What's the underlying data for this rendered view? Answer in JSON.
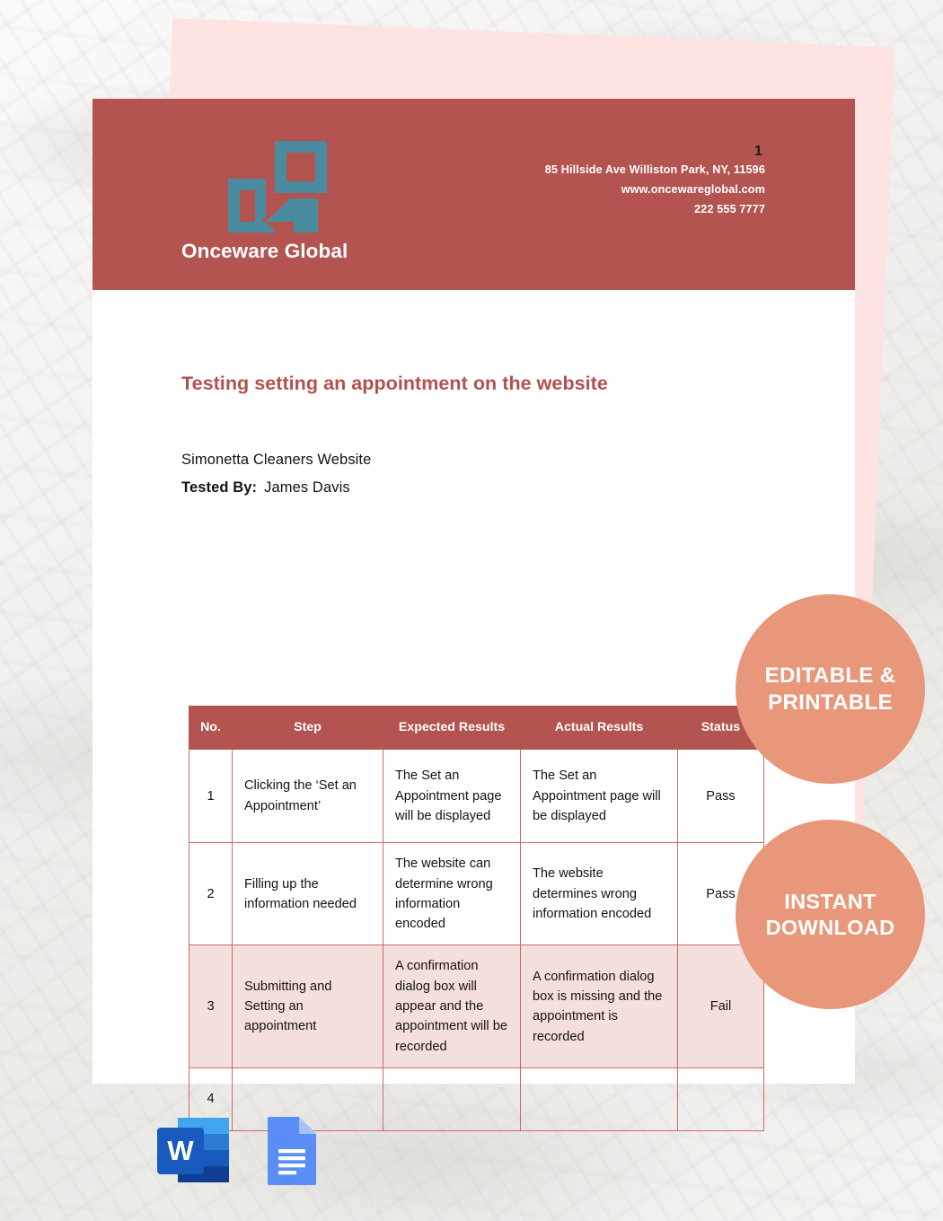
{
  "document": {
    "page_number": "1",
    "brand": {
      "name": "Onceware Global",
      "logo_icon": "onceware-geometric-logo-icon",
      "logo_color": "#4a8ba0",
      "band_color": "#b35450"
    },
    "contact": {
      "address": "85 Hillside Ave Williston Park, NY, 11596",
      "website": "www.oncewareglobal.com",
      "phone": "222 555 7777"
    },
    "title": "Testing setting an appointment on the website",
    "subject": "Simonetta Cleaners Website",
    "tested_by_label": "Tested By:",
    "tested_by_value": "James Davis"
  },
  "table": {
    "headers": [
      "No.",
      "Step",
      "Expected Results",
      "Actual Results",
      "Status"
    ],
    "rows": [
      {
        "no": "1",
        "step": "Clicking the ‘Set an Appointment’",
        "expected": "The Set an Appointment page will be displayed",
        "actual": "The Set an Appointment page will be displayed",
        "status": "Pass",
        "shaded": false
      },
      {
        "no": "2",
        "step": "Filling up the information needed",
        "expected": "The website can determine wrong information encoded",
        "actual": "The website determines wrong information encoded",
        "status": "Pass",
        "shaded": false
      },
      {
        "no": "3",
        "step": "Submitting and Setting an appointment",
        "expected": "A confirmation dialog box will appear and the appointment will be recorded",
        "actual": "A confirmation dialog box is missing and the appointment is recorded",
        "status": "Fail",
        "shaded": true
      },
      {
        "no": "4",
        "step": "",
        "expected": "",
        "actual": "",
        "status": "",
        "shaded": false
      }
    ]
  },
  "badges": {
    "editable": "EDITABLE & PRINTABLE",
    "download": "INSTANT DOWNLOAD",
    "color": "#e8977a"
  },
  "format_icons": [
    {
      "name": "microsoft-word-icon",
      "label": "W"
    },
    {
      "name": "google-docs-icon",
      "label": ""
    }
  ],
  "colors": {
    "brand_red": "#b35450",
    "title_red": "#b3504c",
    "table_border": "#ca6d62",
    "shaded_row": "#f3e0dd",
    "logo_teal": "#4a8ba0",
    "pink_sheet": "#fde3e2"
  }
}
